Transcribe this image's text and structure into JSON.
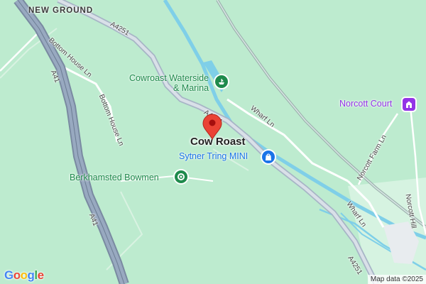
{
  "map": {
    "colors": {
      "land": "#bdebcf",
      "water": "#7fcfe8",
      "major_road": "#8fa0b7",
      "minor_road": "#ffffff",
      "marker": "#ea4335",
      "poi_green": "#1f8a4c",
      "poi_blue": "#1a73e8",
      "poi_purple": "#9334e6"
    },
    "place_name": "NEW GROUND",
    "locality": "Cow Roast",
    "roads": {
      "a41_upper": "A41",
      "a41_lower": "A41",
      "a4251_top": "A4251",
      "a4251_mid": "A4251",
      "a4251_bottom": "A4251",
      "bottom_house_1": "Bottom House Ln",
      "bottom_house_2": "Bottom House Ln",
      "wharf_ln_1": "Wharf Ln",
      "wharf_ln_2": "Wharf Ln",
      "norcott_farm": "Norcott Farm Ln",
      "norcott_hill": "Norcott Hill"
    },
    "pois": {
      "marina_line1": "Cowroast Waterside",
      "marina_line2": "& Marina",
      "marina_icon": "boat-icon",
      "sytner": "Sytner Tring MINI",
      "sytner_icon": "shopping-bag-icon",
      "bowmen": "Berkhamsted Bowmen",
      "bowmen_icon": "park-icon",
      "norcott": "Norcott Court",
      "norcott_icon": "landmark-icon"
    },
    "marker_icon": "location-pin-icon",
    "logo": {
      "letters": [
        "G",
        "o",
        "o",
        "g",
        "l",
        "e"
      ],
      "colors": [
        "#4285F4",
        "#EA4335",
        "#FBBC05",
        "#4285F4",
        "#34A853",
        "#EA4335"
      ]
    },
    "attribution": "Map data ©2025"
  }
}
